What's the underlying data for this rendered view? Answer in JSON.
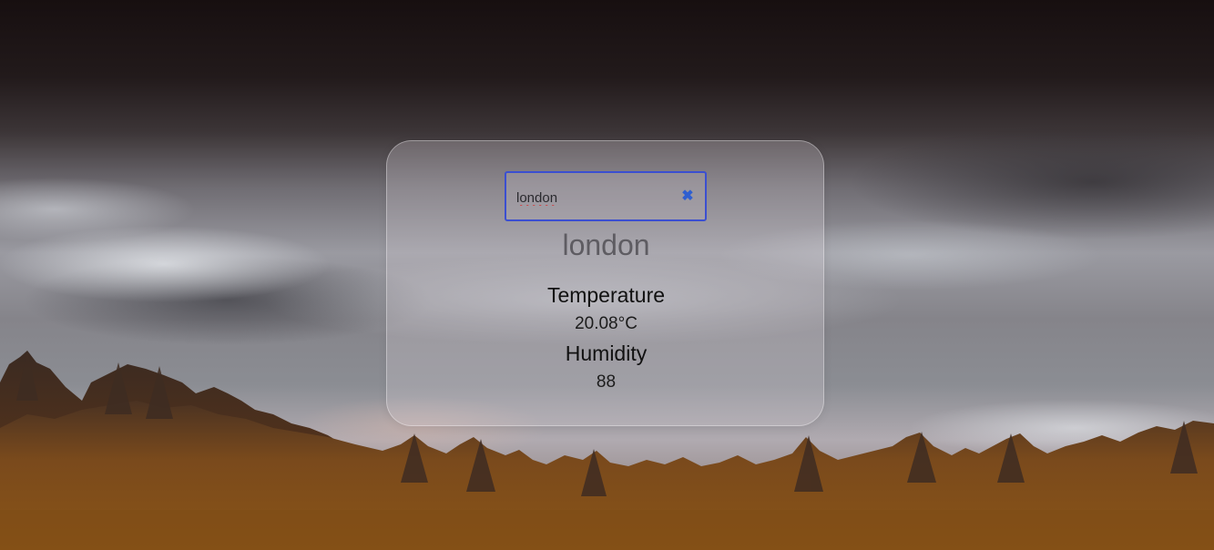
{
  "search": {
    "value": "london",
    "clear_icon": "close-icon",
    "clear_glyph": "✖"
  },
  "weather": {
    "city": "london",
    "temperature_label": "Temperature",
    "temperature_value": "20.08°C",
    "humidity_label": "Humidity",
    "humidity_value": "88"
  },
  "colors": {
    "input_border": "#3b4fd0",
    "clear_icon": "#2f5fd0"
  }
}
